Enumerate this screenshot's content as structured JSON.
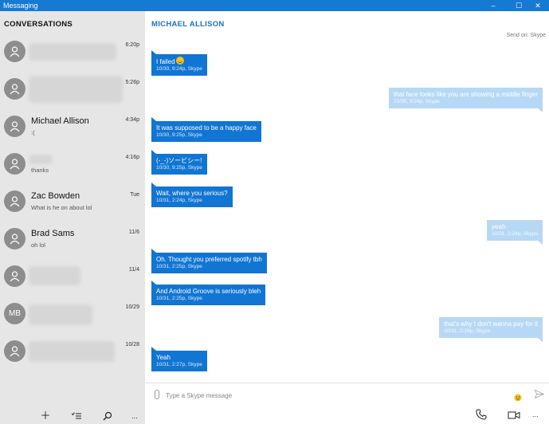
{
  "window": {
    "title": "Messaging"
  },
  "sidebar": {
    "header": "CONVERSATIONS",
    "conversations": [
      {
        "name": "",
        "preview": "",
        "time": "6:20p",
        "avatar": "person-icon",
        "blurred": true
      },
      {
        "name": "",
        "preview": "",
        "time": "5:26p",
        "avatar": "person-icon",
        "blurred": true
      },
      {
        "name": "Michael Allison",
        "preview": ":(",
        "time": "4:34p",
        "avatar": "person-icon",
        "blurred": false
      },
      {
        "name": "",
        "preview": "thanks",
        "time": "4:16p",
        "avatar": "person-icon",
        "blurred": true
      },
      {
        "name": "Zac Bowden",
        "preview": "What is he on about lol",
        "time": "Tue",
        "avatar": "person-icon",
        "blurred": false
      },
      {
        "name": "Brad Sams",
        "preview": "oh lol",
        "time": "11/6",
        "avatar": "person-icon",
        "blurred": false
      },
      {
        "name": "",
        "preview": "",
        "time": "11/4",
        "avatar": "person-icon",
        "blurred": true
      },
      {
        "name": "",
        "preview": "",
        "time": "10/29",
        "initials": "MB",
        "blurred": true
      },
      {
        "name": "",
        "preview": "",
        "time": "10/28",
        "avatar": "person-icon",
        "blurred": true
      }
    ],
    "bottom_icons": [
      "plus-icon",
      "select-list-icon",
      "search-icon",
      "more-icon"
    ],
    "more_label": "..."
  },
  "chat": {
    "contact": "MICHAEL ALLISON",
    "send_on": "Send on: Skype",
    "messages": [
      {
        "dir": "in",
        "text": "I failed",
        "emoji": true,
        "meta": "10/30, 9:24p, Skype"
      },
      {
        "dir": "out",
        "text": "that face looks like you are showing a middle finger",
        "meta": "10/30, 9:24p, Skype"
      },
      {
        "dir": "in",
        "text": "It was supposed to be a happy face",
        "meta": "10/30, 9:25p, Skype"
      },
      {
        "dir": "in",
        "text": "(-_-)ソービシー!",
        "meta": "10/30, 9:25p, Skype"
      },
      {
        "dir": "in",
        "text": "Wait, where you serious?",
        "meta": "10/31, 2:24p, Skype"
      },
      {
        "dir": "out",
        "text": "yeah",
        "meta": "10/31, 2:24p, Skype"
      },
      {
        "dir": "in",
        "text": "Oh. Thought you preferred spotify tbh",
        "meta": "10/31, 2:25p, Skype"
      },
      {
        "dir": "in",
        "text": "And Android  Groove is seriously bleh",
        "meta": "10/31, 2:25p, Skype"
      },
      {
        "dir": "out",
        "text": "that's why I don't wanna pay for it",
        "meta": "10/31, 2:26p, Skype"
      },
      {
        "dir": "in",
        "text": "Yeah",
        "meta": "10/31, 2:27p, Skype"
      }
    ],
    "composer": {
      "placeholder": "Type a Skype message",
      "value": ""
    },
    "call_icons": [
      "phone-icon",
      "video-icon",
      "more-icon"
    ],
    "more_label": "..."
  },
  "colors": {
    "accent": "#1679d2",
    "incoming": "#1175d3",
    "outgoing": "#b7d8f5",
    "sidebar": "#e6e6e6"
  }
}
